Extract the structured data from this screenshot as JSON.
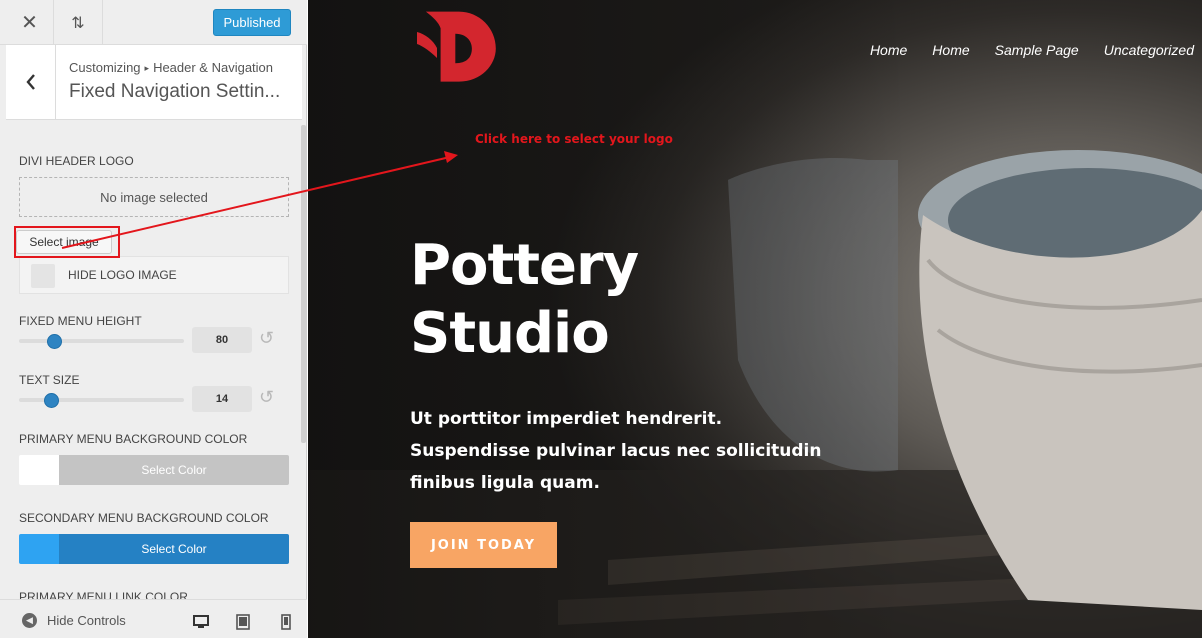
{
  "customizer": {
    "topbar": {
      "close_icon": "close-icon",
      "reorder_icon": "reorder-arrows-icon",
      "publish_label": "Published"
    },
    "section": {
      "breadcrumb_root": "Customizing",
      "breadcrumb_parent": "Header & Navigation",
      "title": "Fixed Navigation Settin..."
    },
    "controls": {
      "header_logo_label": "DIVI HEADER LOGO",
      "no_image_text": "No image selected",
      "select_image_label": "Select image",
      "hide_logo_label": "HIDE LOGO IMAGE",
      "fixed_menu_height_label": "FIXED MENU HEIGHT",
      "fixed_menu_height_value": "80",
      "text_size_label": "TEXT SIZE",
      "text_size_value": "14",
      "primary_bg_label": "PRIMARY MENU BACKGROUND COLOR",
      "primary_bg_button": "Select Color",
      "primary_bg_color": "#ffffff",
      "secondary_bg_label": "SECONDARY MENU BACKGROUND COLOR",
      "secondary_bg_button": "Select Color",
      "secondary_bg_color": "#2ea3f2",
      "primary_link_label": "PRIMARY MENU LINK COLOR"
    },
    "bottombar": {
      "hide_controls_label": "Hide Controls",
      "devices": [
        "desktop-icon",
        "tablet-icon",
        "mobile-icon"
      ]
    }
  },
  "preview": {
    "nav": [
      "Home",
      "Home",
      "Sample Page",
      "Uncategorized"
    ],
    "annotation": "Click here to select your logo",
    "hero_title_line1": "Pottery",
    "hero_title_line2": "Studio",
    "hero_body_line1": "Ut porttitor imperdiet hendrerit.",
    "hero_body_line2": "Suspendisse pulvinar lacus nec sollicitudin",
    "hero_body_line3": "finibus ligula quam.",
    "cta_label": "JOIN TODAY",
    "logo_color": "#d3262e",
    "cta_color": "#f8a564"
  }
}
